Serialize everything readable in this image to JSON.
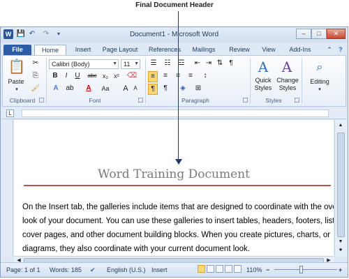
{
  "callout": {
    "text": "Final Document Header"
  },
  "window": {
    "title": "Document1 - Microsoft Word",
    "qat": {
      "save": "💾",
      "undo": "↶",
      "redo": "↷"
    },
    "controls": {
      "minimize": "–",
      "maximize": "□",
      "close": "✕"
    }
  },
  "tabs": [
    "File",
    "Home",
    "Insert",
    "Page Layout",
    "References",
    "Mailings",
    "Review",
    "View",
    "Add-Ins"
  ],
  "ribbon": {
    "clipboard": {
      "label": "Clipboard",
      "paste": "Paste"
    },
    "font": {
      "label": "Font",
      "name": "Calibri (Body)",
      "size": "11",
      "bold": "B",
      "italic": "I",
      "underline": "U",
      "strike": "abc",
      "sub": "x₂",
      "sup": "x²",
      "grow": "A",
      "shrink": "A",
      "case": "Aa",
      "clear": "A"
    },
    "paragraph": {
      "label": "Paragraph"
    },
    "styles": {
      "label": "Styles",
      "quick": "Quick",
      "quick2": "Styles",
      "change": "Change",
      "change2": "Styles"
    },
    "editing": {
      "label": "Editing"
    }
  },
  "document": {
    "heading": "Word Training Document",
    "paragraph_lines": [
      "On the Insert tab, the galleries include items that are designed to coordinate with the overa",
      "look of your document. You can use these galleries to insert tables, headers, footers, lists,",
      "cover pages, and other document building blocks. When you create pictures, charts, or",
      "diagrams, they also coordinate with your current document look."
    ]
  },
  "status": {
    "page": "Page: 1 of 1",
    "words": "Words: 185",
    "language": "English (U.S.)",
    "mode": "Insert",
    "zoom": "110%",
    "zoom_minus": "−",
    "zoom_plus": "+"
  },
  "colors": {
    "accent": "#2c5ea8",
    "heading_rule": "#c0504d",
    "arrow": "#233a68"
  }
}
